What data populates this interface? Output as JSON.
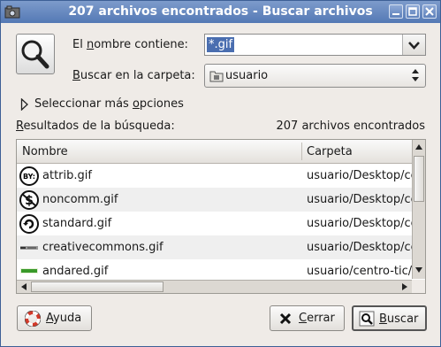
{
  "window": {
    "title": "207 archivos encontrados - Buscar archivos",
    "icons": [
      "app-icon",
      "minimize-icon",
      "maximize-icon",
      "close-icon"
    ]
  },
  "form": {
    "name_label_pre": "El ",
    "name_label_mn": "n",
    "name_label_post": "ombre contiene:",
    "name_value": "*.gif",
    "folder_label_mn": "B",
    "folder_label_post": "uscar en la carpeta:",
    "folder_value": "usuario",
    "more_options_pre": "Seleccionar más ",
    "more_options_mn": "o",
    "more_options_post": "pciones"
  },
  "results": {
    "label_mn": "R",
    "label_post": "esultados de la búsqueda:",
    "count_text": "207 archivos encontrados",
    "columns": [
      "Nombre",
      "Carpeta"
    ],
    "rows": [
      {
        "icon": "cc-by-icon",
        "name": "attrib.gif",
        "folder": "usuario/Desktop/cc"
      },
      {
        "icon": "cc-noncommercial-icon",
        "name": "noncomm.gif",
        "folder": "usuario/Desktop/cc"
      },
      {
        "icon": "cc-sharealike-icon",
        "name": "standard.gif",
        "folder": "usuario/Desktop/cc"
      },
      {
        "icon": "creativecommons-banner-icon",
        "name": "creativecommons.gif",
        "folder": "usuario/Desktop/cc"
      },
      {
        "icon": "andared-banner-icon",
        "name": "andared.gif",
        "folder": "usuario/centro-tic/"
      }
    ]
  },
  "buttons": {
    "help_mn": "A",
    "help_post": "yuda",
    "close_mn": "C",
    "close_post": "errar",
    "find_mn": "B",
    "find_post": "uscar"
  },
  "colors": {
    "titlebar": "#5f82bc",
    "selection": "#4a6eb0",
    "window_bg": "#efebe7"
  }
}
